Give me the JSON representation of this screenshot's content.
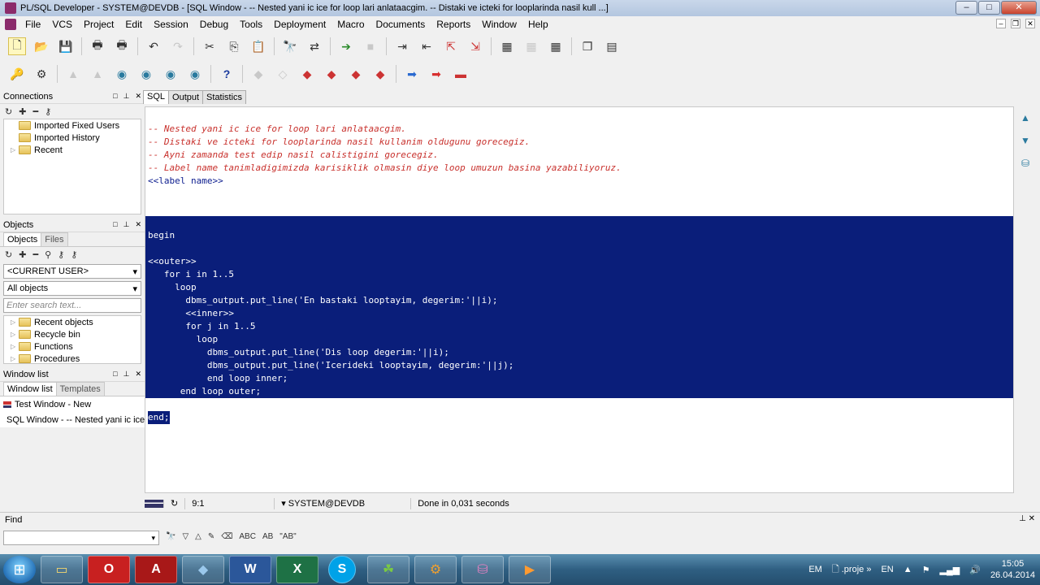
{
  "window": {
    "title": "PL/SQL Developer - SYSTEM@DEVDB - [SQL Window - -- Nested yani ic ice for loop lari anlataacgim. -- Distaki ve icteki for looplarinda nasil kull ...]",
    "buttons": [
      "–",
      "□",
      "✕"
    ]
  },
  "menu": [
    "File",
    "VCS",
    "Project",
    "Edit",
    "Session",
    "Debug",
    "Tools",
    "Deployment",
    "Macro",
    "Documents",
    "Reports",
    "Window",
    "Help"
  ],
  "left_panel": {
    "connections": {
      "title": "Connections",
      "items": [
        "Imported Fixed Users",
        "Imported History",
        "Recent"
      ]
    },
    "objects": {
      "title": "Objects",
      "tabs": [
        "Objects",
        "Files"
      ],
      "user_combo": "<CURRENT USER>",
      "filter_combo": "All objects",
      "search_placeholder": "Enter search text...",
      "items": [
        "Recent objects",
        "Recycle bin",
        "Functions",
        "Procedures"
      ]
    },
    "window_list": {
      "title": "Window list",
      "tabs": [
        "Window list",
        "Templates"
      ],
      "items": [
        "Test Window - New",
        "SQL Window - -- Nested yani ic ice"
      ]
    }
  },
  "editor": {
    "tabs": [
      "SQL",
      "Output",
      "Statistics"
    ],
    "comments": [
      "-- Nested yani ic ice for loop lari anlataacgim.",
      "-- Distaki ve icteki for looplarinda nasil kullanim oldugunu gorecegiz.",
      "-- Ayni zamanda test edip nasil calistigini gorecegiz.",
      "-- Label name tanimladigimizda karisiklik olmasin diye loop umuzun basina yazabiliyoruz."
    ],
    "label_line": "<<label name>>",
    "selected_lines": [
      "begin",
      "",
      "<<outer>>",
      "   for i in 1..5",
      "     loop",
      "       dbms_output.put_line('En bastaki looptayim, degerim:'||i);",
      "       <<inner>>",
      "       for j in 1..5",
      "         loop",
      "           dbms_output.put_line('Dis loop degerim:'||i);",
      "           dbms_output.put_line('Icerideki looptayim, degerim:'||j);",
      "           end loop inner;",
      "      end loop outer;",
      ""
    ],
    "end_line": "end;"
  },
  "status": {
    "position": "9:1",
    "connection": "SYSTEM@DEVDB",
    "message": "Done in 0,031 seconds"
  },
  "find": {
    "label": "Find",
    "tool_labels": [
      "ABC",
      "AB",
      "\"AB\""
    ]
  },
  "taskbar": {
    "lang": "EM",
    "lang2": "EN",
    "file": ".proje",
    "time": "15:05",
    "date": "26.04.2014",
    "apps": [
      "O",
      "A",
      "W",
      "X",
      "S"
    ]
  },
  "colors": {
    "selection": "#0a1e7a",
    "comment": "#c8302c",
    "label": "#102090"
  }
}
